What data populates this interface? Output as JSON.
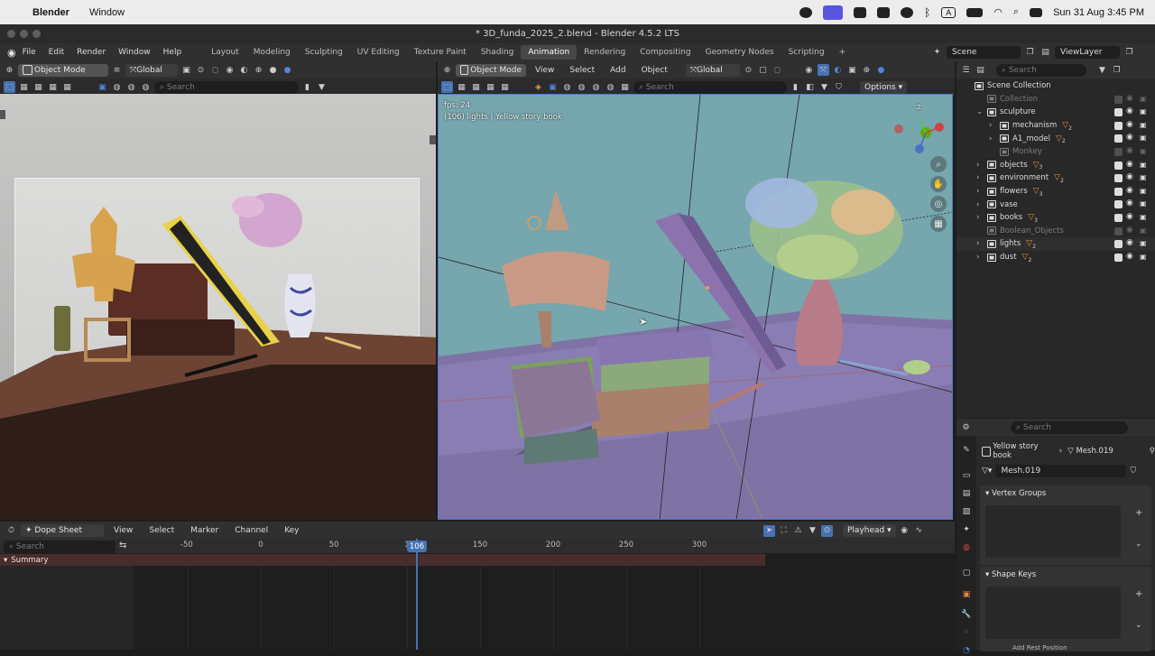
{
  "mac": {
    "apple": "",
    "app": "Blender",
    "menus": [
      "Window"
    ],
    "datetime": "Sun 31 Aug  3:45 PM",
    "input_badge": "A"
  },
  "window": {
    "title": "* 3D_funda_2025_2.blend - Blender 4.5.2 LTS"
  },
  "topbar": {
    "menus": [
      "File",
      "Edit",
      "Render",
      "Window",
      "Help"
    ],
    "workspaces": [
      "Layout",
      "Modeling",
      "Sculpting",
      "UV Editing",
      "Texture Paint",
      "Shading",
      "Animation",
      "Rendering",
      "Compositing",
      "Geometry Nodes",
      "Scripting"
    ],
    "active_workspace": "Animation",
    "add": "+",
    "scene": "Scene",
    "view_layer": "ViewLayer"
  },
  "left_editor": {
    "mode": "Object Mode",
    "orientation": "Global",
    "search_placeholder": "Search"
  },
  "viewport": {
    "mode": "Object Mode",
    "menus": [
      "View",
      "Select",
      "Add",
      "Object"
    ],
    "orientation": "Global",
    "search_placeholder": "Search",
    "options": "Options",
    "fps": "fps: 24",
    "info": "(106) lights | Yellow story book",
    "gizmo_z": "Z"
  },
  "outliner": {
    "search_placeholder": "Search",
    "rows": [
      {
        "label": "Scene Collection",
        "dim": false
      },
      {
        "label": "Collection",
        "dim": true
      },
      {
        "label": "sculpture",
        "dim": false
      },
      {
        "label": "mechanism",
        "dim": false,
        "badge": "2"
      },
      {
        "label": "A1_model",
        "dim": false,
        "badge": "2"
      },
      {
        "label": "Monkey",
        "dim": true
      },
      {
        "label": "objects",
        "dim": false,
        "badge": "3"
      },
      {
        "label": "environment",
        "dim": false,
        "badge": "2"
      },
      {
        "label": "flowers",
        "dim": false,
        "badge": "3"
      },
      {
        "label": "vase",
        "dim": false
      },
      {
        "label": "books",
        "dim": false,
        "badge": "3"
      },
      {
        "label": "Boolean_Objects",
        "dim": true
      },
      {
        "label": "lights",
        "dim": false,
        "badge": "2"
      },
      {
        "label": "dust",
        "dim": false,
        "badge": "2"
      }
    ]
  },
  "properties": {
    "search_placeholder": "Search",
    "object": "Yellow story book",
    "mesh": "Mesh.019",
    "mesh_field": "Mesh.019",
    "panels": [
      "Vertex Groups",
      "Shape Keys",
      "Add Rest Position"
    ]
  },
  "dopesheet": {
    "editor": "Dope Sheet",
    "menus": [
      "View",
      "Select",
      "Marker",
      "Channel",
      "Key"
    ],
    "search_placeholder": "Search",
    "playhead_label": "Playhead",
    "current_frame": "106",
    "summary": "Summary",
    "ruler": [
      {
        "label": "-50",
        "frame": -50
      },
      {
        "label": "0",
        "frame": 0
      },
      {
        "label": "50",
        "frame": 50
      },
      {
        "label": "1",
        "frame": 100
      },
      {
        "label": "150",
        "frame": 150
      },
      {
        "label": "200",
        "frame": 200
      },
      {
        "label": "250",
        "frame": 250
      },
      {
        "label": "300",
        "frame": 300
      }
    ]
  }
}
